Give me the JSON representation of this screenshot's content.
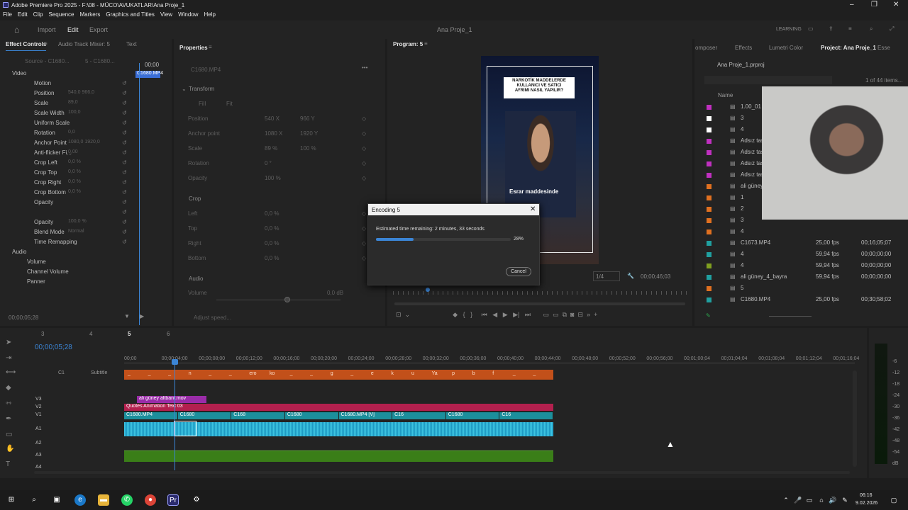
{
  "window": {
    "title": "Adobe Premiere Pro 2025 - F:\\08 - MÜCO\\AVUKATLAR\\Ana Proje_1"
  },
  "menu": [
    "File",
    "Edit",
    "Clip",
    "Sequence",
    "Markers",
    "Graphics and Titles",
    "View",
    "Window",
    "Help"
  ],
  "workspace": {
    "tabs": [
      "Import",
      "Edit",
      "Export"
    ],
    "project_name": "Ana Proje_1",
    "learning": "LEARNING"
  },
  "effect_controls": {
    "tabs": [
      "Effect Controls",
      "Audio Track Mixer: 5",
      "Text"
    ],
    "source": "Source - C1680...",
    "seq": "5 - C1680...",
    "time": "00;00",
    "clip_label": "C1680.MP4",
    "section_video": "Video",
    "section_audio": "Audio",
    "timecode": "00;00;05;28",
    "rows": [
      {
        "label": "Motion",
        "value": ""
      },
      {
        "label": "Position",
        "value": "540,0     966,0"
      },
      {
        "label": "Scale",
        "value": "89,0"
      },
      {
        "label": "Scale Width",
        "value": "100,0"
      },
      {
        "label": "Uniform Scale",
        "value": ""
      },
      {
        "label": "Rotation",
        "value": "0,0"
      },
      {
        "label": "Anchor Point",
        "value": "1080,0    1920,0"
      },
      {
        "label": "Anti-flicker Fi...",
        "value": "0,00"
      },
      {
        "label": "Crop Left",
        "value": "0,0 %"
      },
      {
        "label": "Crop Top",
        "value": "0,0 %"
      },
      {
        "label": "Crop Right",
        "value": "0,0 %"
      },
      {
        "label": "Crop Bottom",
        "value": "0,0 %"
      },
      {
        "label": "Opacity",
        "value": ""
      },
      {
        "label": "",
        "value": ""
      },
      {
        "label": "Opacity",
        "value": "100,0 %"
      },
      {
        "label": "Blend Mode",
        "value": "Normal"
      },
      {
        "label": "Time Remapping",
        "value": ""
      }
    ],
    "audio_rows": [
      "Volume",
      "Channel Volume",
      "Panner"
    ]
  },
  "properties": {
    "title": "Properties",
    "clip": "C1680.MP4",
    "transform": "Transform",
    "fill": "Fill",
    "fit": "Fit",
    "rows": [
      {
        "label": "Position",
        "v1": "540 X",
        "v2": "966 Y"
      },
      {
        "label": "Anchor point",
        "v1": "1080 X",
        "v2": "1920 Y"
      },
      {
        "label": "Scale",
        "v1": "89 %",
        "v2": "100 %"
      },
      {
        "label": "Rotation",
        "v1": "0 °",
        "v2": ""
      },
      {
        "label": "Opacity",
        "v1": "100 %",
        "v2": ""
      }
    ],
    "crop": "Crop",
    "crop_rows": [
      {
        "label": "Left",
        "v": "0,0 %"
      },
      {
        "label": "Top",
        "v": "0,0 %"
      },
      {
        "label": "Right",
        "v": "0,0 %"
      },
      {
        "label": "Bottom",
        "v": "0,0 %"
      }
    ],
    "audio": "Audio",
    "volume": "Volume",
    "volume_val": "0,0 dB",
    "adjust": "Adjust speed..."
  },
  "program": {
    "title": "Program: 5",
    "quote": "NARKOTİK MADDELERDE KULLANICI VE SATICI AYRIMI NASIL YAPILIR?",
    "caption": "Esrar maddesinde",
    "zoom": "1/4",
    "timecode": "00;00;46;03"
  },
  "encoding": {
    "title": "Encoding 5",
    "remaining": "Estimated time remaining: 2 minutes, 33 seconds",
    "percent": "28%",
    "progress": 0.28,
    "cancel": "Cancel"
  },
  "project": {
    "tabs": [
      "omposer",
      "Effects",
      "Lumetri Color",
      "Project: Ana Proje_1",
      "Esse"
    ],
    "file": "Ana Proje_1.prproj",
    "count": "1 of 44 items...",
    "name_col": "Name",
    "items": [
      {
        "name": "1.00_01",
        "fps": "",
        "dur": "",
        "color": "#c030c0"
      },
      {
        "name": "3",
        "fps": "",
        "dur": "",
        "color": "#ffffff"
      },
      {
        "name": "4",
        "fps": "",
        "dur": "",
        "color": "#ffffff"
      },
      {
        "name": "Adsız tas",
        "fps": "",
        "dur": "",
        "color": "#c030c0"
      },
      {
        "name": "Adsız tas",
        "fps": "",
        "dur": "",
        "color": "#c030c0"
      },
      {
        "name": "Adsız tas",
        "fps": "",
        "dur": "",
        "color": "#c030c0"
      },
      {
        "name": "Adsız tas",
        "fps": "",
        "dur": "",
        "color": "#c030c0"
      },
      {
        "name": "ali güney",
        "fps": "",
        "dur": "",
        "color": "#e07020"
      },
      {
        "name": "1",
        "fps": "",
        "dur": "",
        "color": "#e07020"
      },
      {
        "name": "2",
        "fps": "",
        "dur": "",
        "color": "#e07020"
      },
      {
        "name": "3",
        "fps": "",
        "dur": "",
        "color": "#e07020"
      },
      {
        "name": "4",
        "fps": "",
        "dur": "",
        "color": "#e07020"
      },
      {
        "name": "C1673.MP4",
        "fps": "25,00 fps",
        "dur": "00;16;05;07",
        "color": "#20a0a0"
      },
      {
        "name": "4",
        "fps": "59,94 fps",
        "dur": "00;00;00;00",
        "color": "#20a0a0"
      },
      {
        "name": "4",
        "fps": "59,94 fps",
        "dur": "00;00;00;00",
        "color": "#80a020"
      },
      {
        "name": "ali güney_4_bayra",
        "fps": "59,94 fps",
        "dur": "00;00;00;00",
        "color": "#20a0a0"
      },
      {
        "name": "5",
        "fps": "",
        "dur": "",
        "color": "#e07020"
      },
      {
        "name": "C1680.MP4",
        "fps": "25,00 fps",
        "dur": "00;30;58;02",
        "color": "#20a0a0"
      }
    ]
  },
  "timeline": {
    "tabs": [
      "3",
      "4",
      "5",
      "6"
    ],
    "timecode": "00;00;05;28",
    "ruler": [
      "00;00",
      "00;00;04;00",
      "00;00;08;00",
      "00;00;12;00",
      "00;00;16;00",
      "00;00;20;00",
      "00;00;24;00",
      "00;00;28;00",
      "00;00;32;00",
      "00;00;36;00",
      "00;00;40;00",
      "00;00;44;00",
      "00;00;48;00",
      "00;00;52;00",
      "00;00;56;00",
      "00;01;00;04",
      "00;01;04;04",
      "00;01;08;04",
      "00;01;12;04",
      "00;01;16;04"
    ],
    "tracks": [
      "C1",
      "Subtitle",
      "V3",
      "V2",
      "V1",
      "A1",
      "A2",
      "A3",
      "A4"
    ],
    "subtitle_words": [
      "_",
      "_",
      "_",
      "n",
      "_",
      "_",
      "ero",
      "ko",
      "_",
      "_",
      "g",
      "_",
      "e",
      "k",
      "u",
      "Ya",
      "p",
      "b",
      "f",
      "_",
      "_"
    ],
    "v3_clip": "ali güney altbant.mov",
    "v2_clip": "Quotes Animation Text 03",
    "v1_clips": [
      "C1680.MP4",
      "C1680",
      "C168",
      "C1680",
      "C1680.MP4 [V]",
      "C16",
      "C1680",
      "C16"
    ],
    "meter_labels": [
      "-6",
      "-12",
      "-18",
      "-24",
      "-30",
      "-36",
      "-42",
      "-48",
      "-54",
      "dB"
    ]
  },
  "taskbar": {
    "time": "06:16",
    "date": "9.02.2026"
  }
}
